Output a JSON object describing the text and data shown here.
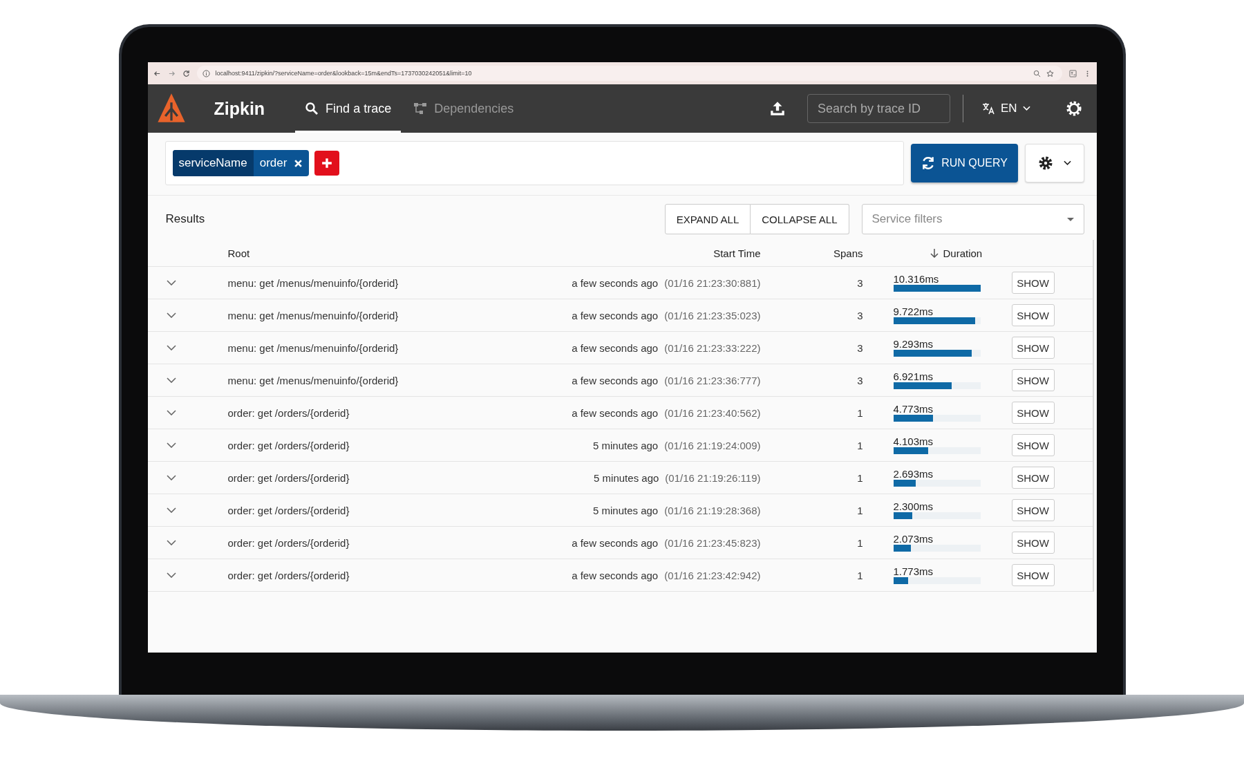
{
  "browser": {
    "url": "localhost:9411/zipkin/?serviceName=order&lookback=15m&endTs=1737030242051&limit=10"
  },
  "header": {
    "app_name": "Zipkin",
    "nav": [
      {
        "label": "Find a trace",
        "kind": "search",
        "selected": true
      },
      {
        "label": "Dependencies",
        "kind": "dependencies",
        "selected": false
      }
    ],
    "search": {
      "placeholder": "Search by trace ID"
    },
    "language": "EN"
  },
  "query": {
    "criteria": [
      {
        "key": "serviceName",
        "value": "order"
      }
    ],
    "run_button": "RUN QUERY"
  },
  "results": {
    "title": "Results",
    "expand_button": "EXPAND ALL",
    "collapse_button": "COLLAPSE ALL",
    "service_filter": {
      "placeholder": "Service filters"
    },
    "columns": [
      {
        "label": "Root",
        "sorted": false
      },
      {
        "label": "Start Time",
        "sorted": false
      },
      {
        "label": "Spans",
        "sorted": false
      },
      {
        "label": "Duration",
        "sorted": true
      }
    ],
    "rows": [
      {
        "root": "menu: get /menus/menuinfo/{orderid}",
        "relative_time": "a few seconds ago",
        "timestamp": "(01/16 21:23:30:881)",
        "spans": "3",
        "duration": "10.316ms",
        "level": 1.0,
        "button": "SHOW"
      },
      {
        "root": "menu: get /menus/menuinfo/{orderid}",
        "relative_time": "a few seconds ago",
        "timestamp": "(01/16 21:23:35:023)",
        "spans": "3",
        "duration": "9.722ms",
        "level": 0.94,
        "button": "SHOW"
      },
      {
        "root": "menu: get /menus/menuinfo/{orderid}",
        "relative_time": "a few seconds ago",
        "timestamp": "(01/16 21:23:33:222)",
        "spans": "3",
        "duration": "9.293ms",
        "level": 0.9,
        "button": "SHOW"
      },
      {
        "root": "menu: get /menus/menuinfo/{orderid}",
        "relative_time": "a few seconds ago",
        "timestamp": "(01/16 21:23:36:777)",
        "spans": "3",
        "duration": "6.921ms",
        "level": 0.67,
        "button": "SHOW"
      },
      {
        "root": "order: get /orders/{orderid}",
        "relative_time": "a few seconds ago",
        "timestamp": "(01/16 21:23:40:562)",
        "spans": "1",
        "duration": "4.773ms",
        "level": 0.46,
        "button": "SHOW"
      },
      {
        "root": "order: get /orders/{orderid}",
        "relative_time": "5 minutes ago",
        "timestamp": "(01/16 21:19:24:009)",
        "spans": "1",
        "duration": "4.103ms",
        "level": 0.4,
        "button": "SHOW"
      },
      {
        "root": "order: get /orders/{orderid}",
        "relative_time": "5 minutes ago",
        "timestamp": "(01/16 21:19:26:119)",
        "spans": "1",
        "duration": "2.693ms",
        "level": 0.26,
        "button": "SHOW"
      },
      {
        "root": "order: get /orders/{orderid}",
        "relative_time": "5 minutes ago",
        "timestamp": "(01/16 21:19:28:368)",
        "spans": "1",
        "duration": "2.300ms",
        "level": 0.22,
        "button": "SHOW"
      },
      {
        "root": "order: get /orders/{orderid}",
        "relative_time": "a few seconds ago",
        "timestamp": "(01/16 21:23:45:823)",
        "spans": "1",
        "duration": "2.073ms",
        "level": 0.2,
        "button": "SHOW"
      },
      {
        "root": "order: get /orders/{orderid}",
        "relative_time": "a few seconds ago",
        "timestamp": "(01/16 21:23:42:942)",
        "spans": "1",
        "duration": "1.773ms",
        "level": 0.17,
        "button": "SHOW"
      }
    ]
  }
}
